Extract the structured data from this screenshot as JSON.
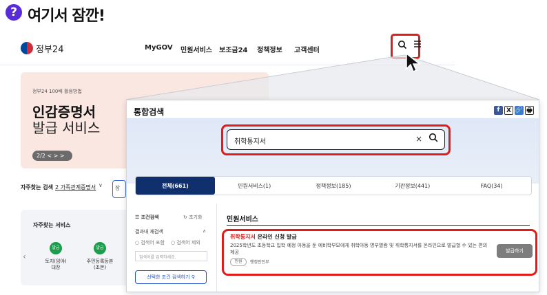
{
  "heading": {
    "icon": "?",
    "text": "여기서 잠깐!"
  },
  "site": {
    "logo": "정부24",
    "nav": [
      "MyGOV",
      "민원서비스",
      "보조금24",
      "정책정보",
      "고객센터"
    ],
    "banner": {
      "small": "정부24 100배 활용방법",
      "line1": "인감증명서",
      "line2": "발급 서비스",
      "pager": "2/2 < > >"
    },
    "frequent": {
      "label": "자주찾는 검색",
      "value": "2 가족관계증명서"
    },
    "frequent_box": "장",
    "services": {
      "title": "자주찾는 서비스",
      "items": [
        {
          "icon": "발급",
          "label": "토지(임야)\n대장"
        },
        {
          "icon": "발급",
          "label": "주민등록등본\n(초본)"
        }
      ]
    }
  },
  "modal": {
    "title": "통합검색",
    "share": [
      "f",
      "X",
      "🔗",
      "🖶"
    ],
    "search": {
      "value": "취학통지서",
      "clear": "×",
      "search_icon": "⌕"
    },
    "tabs": [
      "전체(661)",
      "민원서비스(1)",
      "정책정보(185)",
      "기관정보(441)",
      "FAQ(34)"
    ],
    "filter": {
      "title": "조건검색",
      "reset": "초기화",
      "sub": "결과내 재검색",
      "opt1": "검색어 포함",
      "opt2": "검색어 제외",
      "placeholder": "검색어를 입력하세요.",
      "button": "선택한 조건 검색하기"
    },
    "section_title": "민원서비스",
    "result": {
      "highlight": "취학통지서",
      "rest": " 온라인 신청 발급",
      "desc": "2025학년도 초등학교 입학 예정 아동을 둔 예비학부모에게 취학아동 명부열람 및 취학통지서를 온라인으로 발급할 수 있는 편의 제공",
      "chip": "민원",
      "agency": "행정안전부",
      "button": "발급하기"
    }
  },
  "colors": {
    "highlight": "#e11a1a",
    "active_tab": "#0f2f6d",
    "brand_purple": "#5a2bd8"
  }
}
